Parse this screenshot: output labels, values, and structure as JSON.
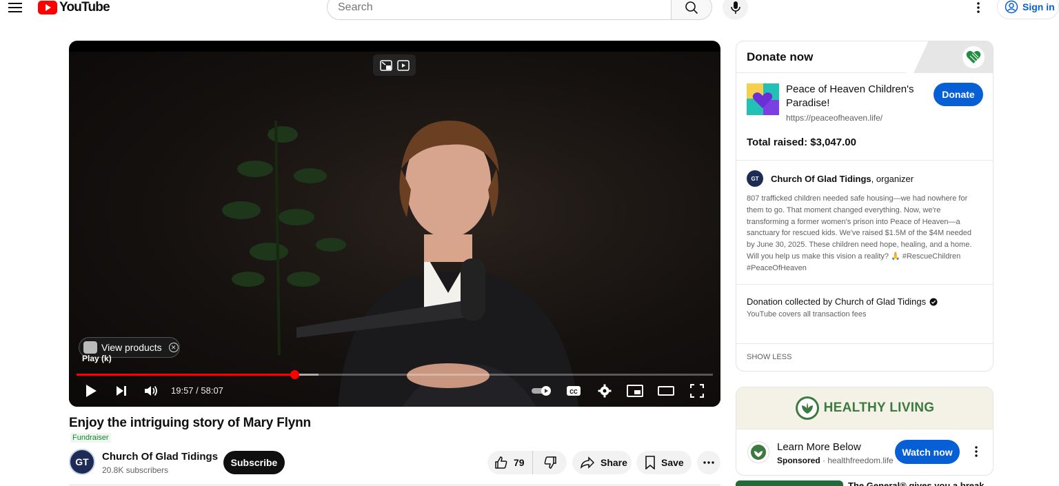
{
  "header": {
    "logo_text": "YouTube",
    "search_placeholder": "Search",
    "sign_in_label": "Sign in"
  },
  "player": {
    "time_current": "19:57",
    "time_total": "58:07",
    "time_display": "19:57 / 58:07",
    "progress_fraction": 0.343,
    "buffered_fraction": 0.38,
    "view_products_label": "View products",
    "play_tooltip": "Play (k)"
  },
  "video": {
    "title": "Enjoy the intriguing story of Mary Flynn",
    "tag": "Fundraiser",
    "channel_name": "Church Of Glad Tidings",
    "subscribers": "20.8K subscribers",
    "subscribe_label": "Subscribe",
    "like_count": "79",
    "share_label": "Share",
    "save_label": "Save"
  },
  "donate_card": {
    "title": "Donate now",
    "charity_name": "Peace of Heaven Children's Paradise!",
    "charity_url": "https://peaceofheaven.life/",
    "donate_label": "Donate",
    "total_raised": "Total raised: $3,047.00",
    "organizer_name": "Church Of Glad Tidings",
    "organizer_suffix": ", organizer",
    "description": "807 trafficked children needed safe housing—we had nowhere for them to go. That moment changed everything. Now, we're transforming a former women's prison into Peace of Heaven—a sanctuary for rescued kids. We've raised $1.5M of the $4M needed by June 30, 2025. These children need hope, healing, and a home. Will you help us make this vision a reality? 🙏 #RescueChildren #PeaceOfHeaven",
    "collected_by": "Donation collected by Church of Glad Tidings",
    "fees_note": "YouTube covers all transaction fees",
    "show_less": "SHOW LESS"
  },
  "ad": {
    "banner_text": "HEALTHY LIVING",
    "headline": "Learn More Below",
    "sponsored": "Sponsored",
    "domain": " · healthfreedom.life",
    "cta": "Watch now"
  },
  "next_item": {
    "title_partial": "The General® gives you a break"
  },
  "colors": {
    "brand_red": "#ff0000",
    "link_blue": "#065fd4",
    "healthy_green": "#3d7a3f"
  }
}
